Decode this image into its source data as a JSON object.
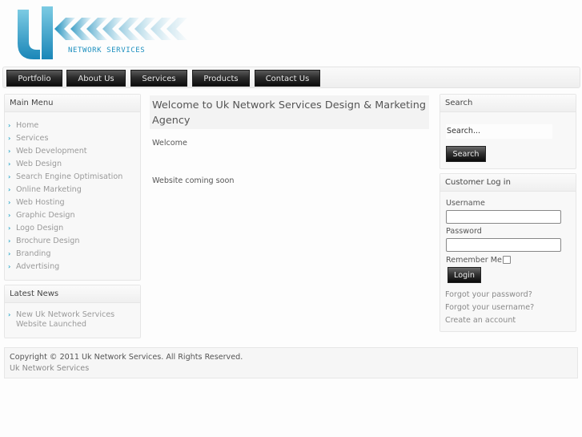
{
  "brand": {
    "logo_letters": "Uk",
    "logo_subtitle": "NETWORK SERVICES",
    "colors": {
      "primary": "#1e90bf",
      "light": "#9fd6e8"
    }
  },
  "nav": {
    "items": [
      {
        "label": "Portfolio"
      },
      {
        "label": "About Us"
      },
      {
        "label": "Services"
      },
      {
        "label": "Products"
      },
      {
        "label": "Contact Us"
      }
    ]
  },
  "main_menu": {
    "title": "Main Menu",
    "bullet_icon": "chevron-right-icon",
    "items": [
      {
        "label": "Home"
      },
      {
        "label": "Services"
      },
      {
        "label": "Web Development"
      },
      {
        "label": "Web Design"
      },
      {
        "label": "Search Engine Optimisation"
      },
      {
        "label": "Online Marketing"
      },
      {
        "label": "Web Hosting"
      },
      {
        "label": "Graphic Design"
      },
      {
        "label": "Logo Design"
      },
      {
        "label": "Brochure Design"
      },
      {
        "label": "Branding"
      },
      {
        "label": "Advertising"
      }
    ]
  },
  "latest_news": {
    "title": "Latest News",
    "items": [
      {
        "label": "New Uk Network Services Website Launched"
      }
    ]
  },
  "main": {
    "title": "Welcome to Uk Network Services Design & Marketing Agency",
    "paragraphs": [
      "Welcome",
      "Website coming soon"
    ]
  },
  "search": {
    "title": "Search",
    "input_value": "Search...",
    "button_label": "Search"
  },
  "login": {
    "title": "Customer Log in",
    "username_label": "Username",
    "username_value": "",
    "password_label": "Password",
    "password_value": "",
    "remember_label": "Remember Me",
    "remember_checked": false,
    "button_label": "Login",
    "links": [
      {
        "label": "Forgot your password?"
      },
      {
        "label": "Forgot your username?"
      },
      {
        "label": "Create an account"
      }
    ]
  },
  "footer": {
    "copyright": "Copyright © 2011 Uk Network Services. All Rights Reserved.",
    "link": "Uk Network Services"
  }
}
